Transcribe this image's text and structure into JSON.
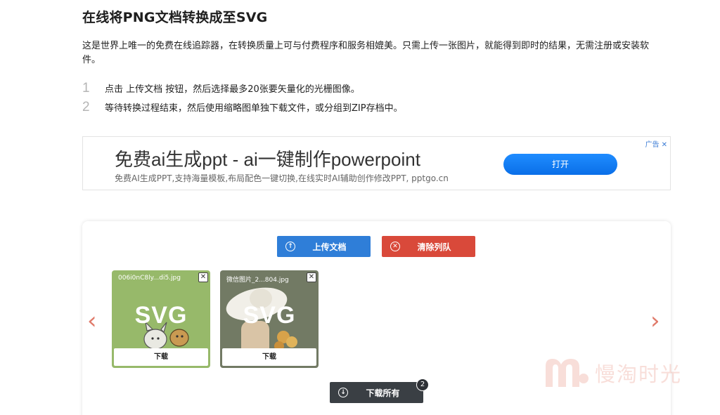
{
  "page": {
    "title": "在线将PNG文档转换成至SVG",
    "intro": "这是世界上唯一的免费在线追踪器，在转换质量上可与付费程序和服务相媲美。只需上传一张图片，就能得到即时的结果，无需注册或安装软件。"
  },
  "steps": [
    {
      "num": "1",
      "text": "点击 上传文档 按钮，然后选择最多20张要矢量化的光栅图像。"
    },
    {
      "num": "2",
      "text": "等待转换过程结束，然后使用缩略图单独下载文件，或分组到ZIP存档中。"
    }
  ],
  "ad": {
    "title": "免费ai生成ppt - ai一键制作powerpoint",
    "subtitle": "免费AI生成PPT,支持海量模板,布局配色一键切换,在线实时AI辅助创作修改PPT, pptgo.cn",
    "button": "打开",
    "mark": "广告",
    "close": "✕"
  },
  "converter": {
    "upload_label": "上传文档",
    "clear_label": "清除列队",
    "download_all_label": "下载所有",
    "queue_count": "2",
    "prev_icon": "chevron-left-icon",
    "next_icon": "chevron-right-icon",
    "files": [
      {
        "name": "006i0nC8ly...di5.jpg",
        "format": "SVG",
        "download": "下载",
        "color": "#97b96a"
      },
      {
        "name": "微信图片_2...804.jpg",
        "format": "SVG",
        "download": "下载",
        "color": "#727a64"
      }
    ]
  },
  "watermark": {
    "text": "慢淘时光"
  },
  "colors": {
    "upload": "#2f7ed8",
    "clear": "#d9493a",
    "download_all": "#3a3f44",
    "arrow": "#e07a6a"
  }
}
